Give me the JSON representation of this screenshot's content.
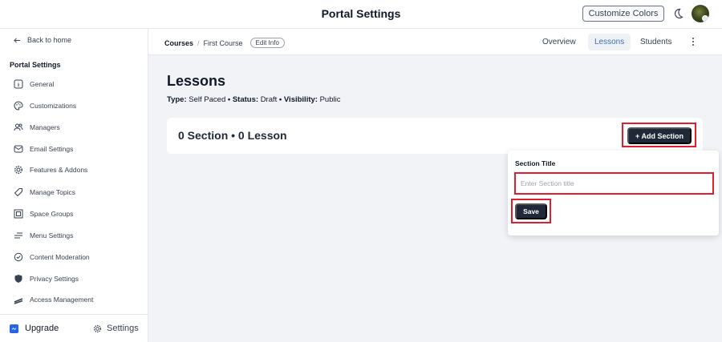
{
  "header": {
    "title": "Portal Settings",
    "customize_label": "Customize Colors"
  },
  "sidebar": {
    "back_label": "Back to home",
    "heading": "Portal Settings",
    "items": [
      {
        "label": "General",
        "icon": "info-box-icon"
      },
      {
        "label": "Customizations",
        "icon": "palette-icon"
      },
      {
        "label": "Managers",
        "icon": "users-icon"
      },
      {
        "label": "Email Settings",
        "icon": "email-icon"
      },
      {
        "label": "Features & Addons",
        "icon": "gear-icon"
      },
      {
        "label": "Manage Topics",
        "icon": "tag-icon"
      },
      {
        "label": "Space Groups",
        "icon": "grid-icon"
      },
      {
        "label": "Menu Settings",
        "icon": "menu-icon"
      },
      {
        "label": "Content Moderation",
        "icon": "check-shield-icon"
      },
      {
        "label": "Privacy Settings",
        "icon": "shield-icon"
      },
      {
        "label": "Access Management",
        "icon": "key-icon"
      }
    ],
    "upgrade_label": "Upgrade",
    "settings_label": "Settings"
  },
  "breadcrumb": {
    "root": "Courses",
    "separator": "/",
    "current": "First Course",
    "edit_label": "Edit Info"
  },
  "tabs": [
    {
      "label": "Overview",
      "active": false
    },
    {
      "label": "Lessons",
      "active": true
    },
    {
      "label": "Students",
      "active": false
    }
  ],
  "main": {
    "title": "Lessons",
    "meta": {
      "type_label": "Type:",
      "type_value": "Self Paced",
      "bullet": "•",
      "status_label": "Status:",
      "status_value": "Draft",
      "visibility_label": "Visibility:",
      "visibility_value": "Public"
    },
    "count_text": "0 Section • 0 Lesson",
    "add_section_label": "+ Add Section"
  },
  "popover": {
    "label": "Section Title",
    "input_placeholder": "Enter Section title",
    "input_value": "",
    "save_label": "Save"
  },
  "colors": {
    "accent": "#3b6fb6",
    "dark_button": "#1f2937",
    "highlight": "#e11d2e",
    "background": "#f1f3f6"
  }
}
